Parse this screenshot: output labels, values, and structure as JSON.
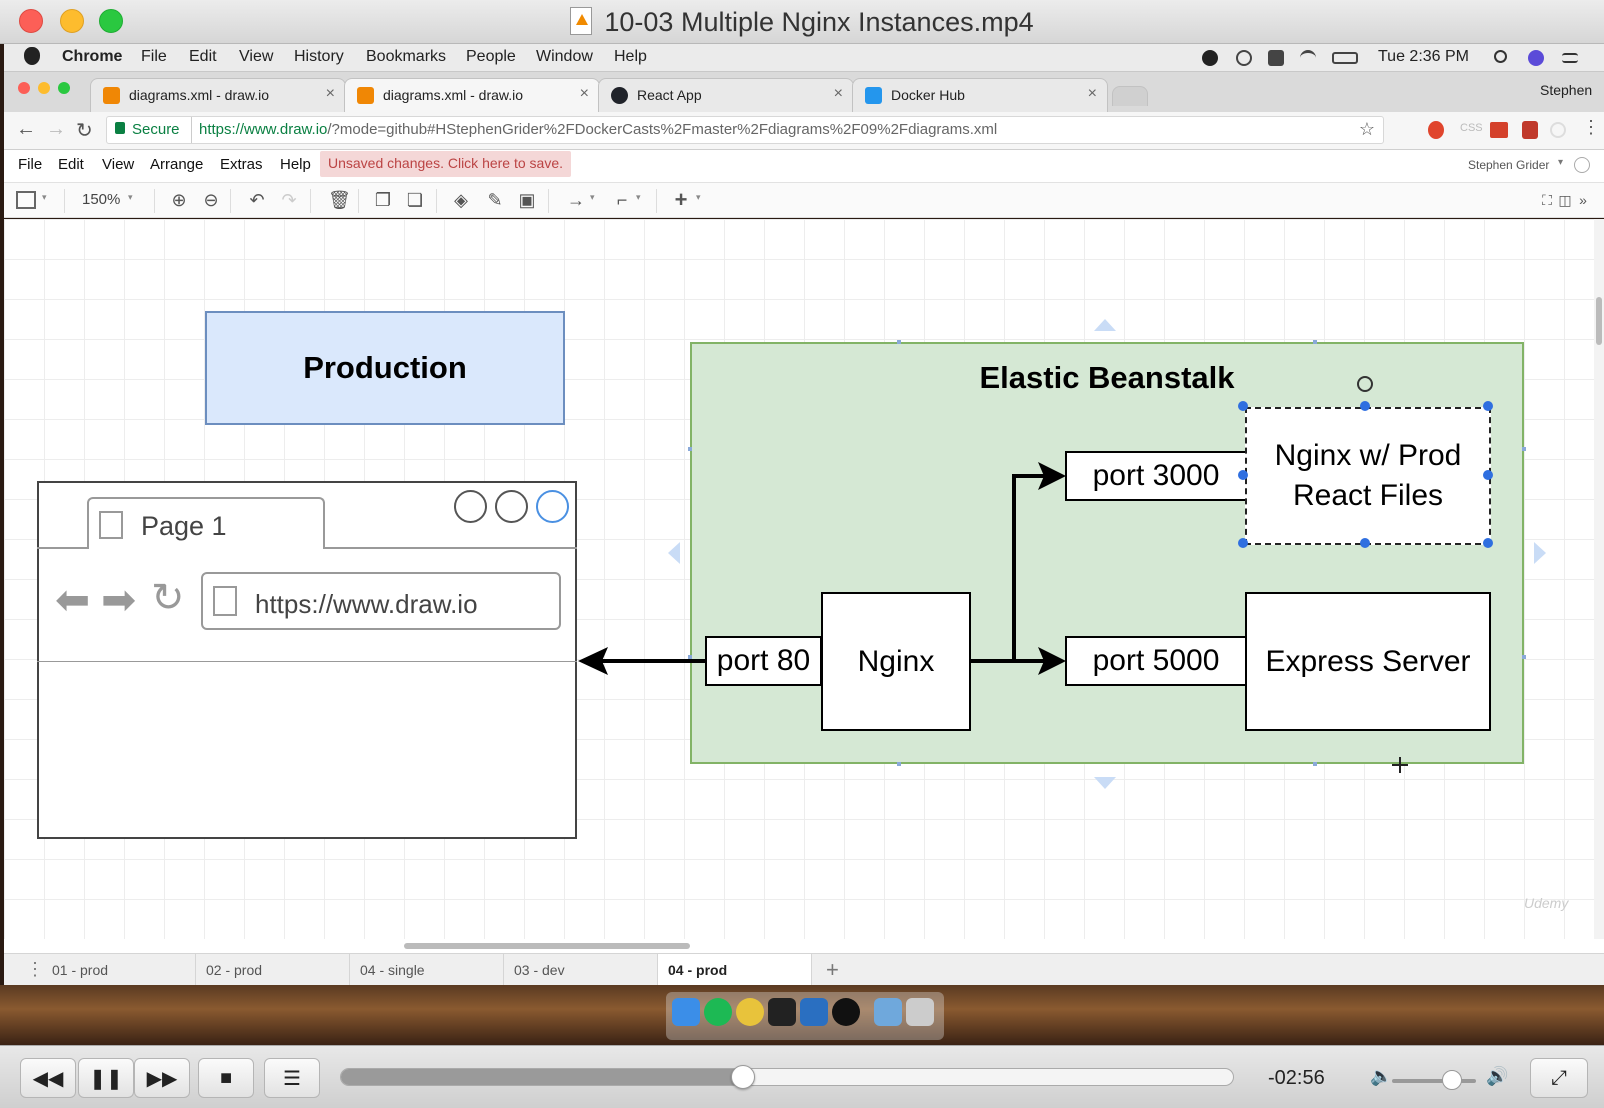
{
  "window": {
    "title": "10-03 Multiple Nginx Instances.mp4",
    "file_badge": "M4V"
  },
  "mac_menu": {
    "app": "Chrome",
    "items": [
      "File",
      "Edit",
      "View",
      "History",
      "Bookmarks",
      "People",
      "Window",
      "Help"
    ],
    "clock": "Tue 2:36 PM"
  },
  "chrome": {
    "tabs": [
      {
        "label": "diagrams.xml - draw.io",
        "active": false,
        "favicon_color": "#f08705"
      },
      {
        "label": "diagrams.xml - draw.io",
        "active": true,
        "favicon_color": "#f08705"
      },
      {
        "label": "React App",
        "active": false,
        "favicon_color": "#20232a"
      },
      {
        "label": "Docker Hub",
        "active": false,
        "favicon_color": "#2496ed"
      }
    ],
    "profile": "Stephen",
    "secure_label": "Secure",
    "url_host": "https://www.draw.io",
    "url_rest": "/?mode=github#HStephenGrider%2FDockerCasts%2Fmaster%2Fdiagrams%2F09%2Fdiagrams.xml",
    "ext_css": "CSS"
  },
  "drawio": {
    "menu": [
      "File",
      "Edit",
      "View",
      "Arrange",
      "Extras",
      "Help"
    ],
    "unsaved": "Unsaved changes. Click here to save.",
    "user": "Stephen Grider",
    "zoom": "150%",
    "page_tabs": [
      {
        "label": "01 - prod",
        "active": false
      },
      {
        "label": "02 - prod",
        "active": false
      },
      {
        "label": "04 - single",
        "active": false
      },
      {
        "label": "03 - dev",
        "active": false
      },
      {
        "label": "04 - prod",
        "active": true
      }
    ]
  },
  "diagram": {
    "production_label": "Production",
    "browser": {
      "tab": "Page 1",
      "url": "https://www.draw.io"
    },
    "eb_title": "Elastic Beanstalk",
    "port80": "port 80",
    "nginx": "Nginx",
    "port3000": "port 3000",
    "port5000": "port 5000",
    "nginx_prod": [
      "Nginx w/ Prod",
      "React Files"
    ],
    "express": "Express Server",
    "colors": {
      "production_fill": "#dae8fc",
      "production_stroke": "#6c8ebf",
      "eb_fill": "#d5e8d4",
      "eb_stroke": "#82b366",
      "selection": "#2f6fe0"
    }
  },
  "player": {
    "remaining": "-02:56",
    "progress": 0.45,
    "volume": 0.72
  },
  "watermark": "Udemy"
}
